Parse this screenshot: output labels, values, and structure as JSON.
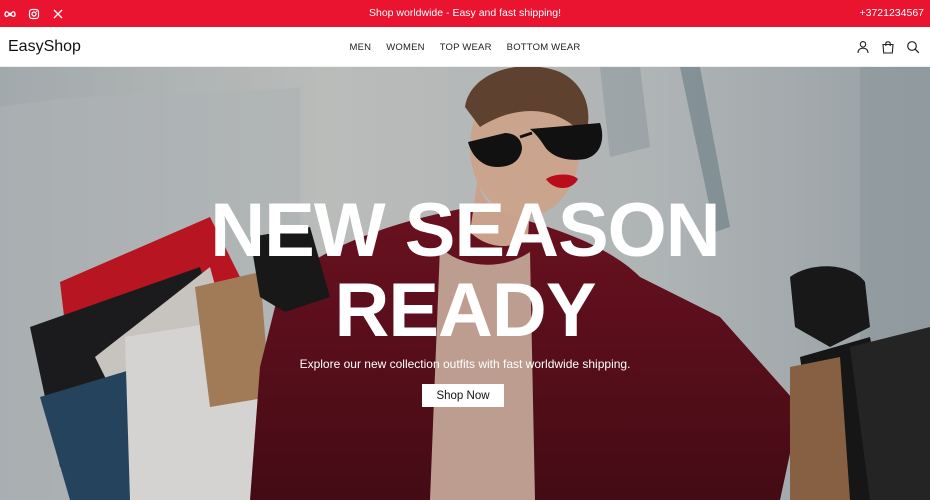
{
  "topbar": {
    "promo": "Shop worldwide - Easy and fast shipping!",
    "phone": "+3721234567",
    "socials": [
      "meta-icon",
      "instagram-icon",
      "x-icon"
    ],
    "background": "#ea1330"
  },
  "header": {
    "logo": "EasyShop",
    "nav": [
      "MEN",
      "WOMEN",
      "TOP WEAR",
      "BOTTOM WEAR"
    ],
    "icons": [
      "user-icon",
      "bag-icon",
      "search-icon"
    ]
  },
  "hero": {
    "title_line1": "NEW SEASON",
    "title_line2": "READY",
    "subtitle": "Explore our new collection outfits with fast worldwide shipping.",
    "cta": "Shop Now"
  }
}
